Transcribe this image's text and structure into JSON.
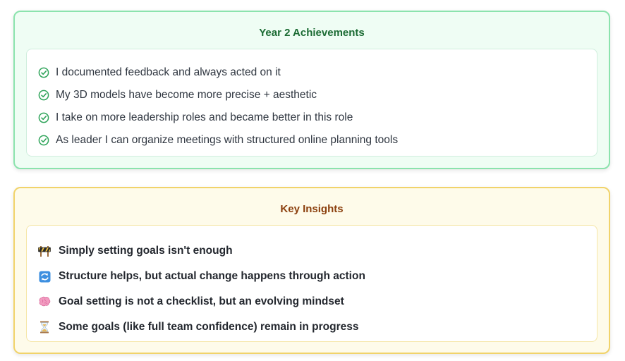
{
  "achievements": {
    "title": "Year 2 Achievements",
    "items": [
      {
        "icon": "check-circle-icon",
        "text": "I documented feedback and always acted on it"
      },
      {
        "icon": "check-circle-icon",
        "text": "My 3D models have become more precise + aesthetic"
      },
      {
        "icon": "check-circle-icon",
        "text": "I take on more leadership roles and became better in this role"
      },
      {
        "icon": "check-circle-icon",
        "text": "As leader I can organize meetings with structured online planning tools"
      }
    ],
    "colors": {
      "background": "#effdf4",
      "border": "#8be3ad",
      "title": "#1b6b33",
      "check": "#2fa45a"
    }
  },
  "insights": {
    "title": "Key Insights",
    "items": [
      {
        "icon": "construction-barrier-icon",
        "text": "Simply setting goals isn't enough"
      },
      {
        "icon": "repeat-arrows-icon",
        "text": "Structure helps, but actual change happens through action"
      },
      {
        "icon": "brain-icon",
        "text": "Goal setting is not a checklist, but an evolving mindset"
      },
      {
        "icon": "hourglass-icon",
        "text": "Some goals (like full team confidence) remain in progress"
      }
    ],
    "colors": {
      "background": "#fefbea",
      "border": "#f1d36a",
      "title": "#8b3f0d"
    }
  }
}
